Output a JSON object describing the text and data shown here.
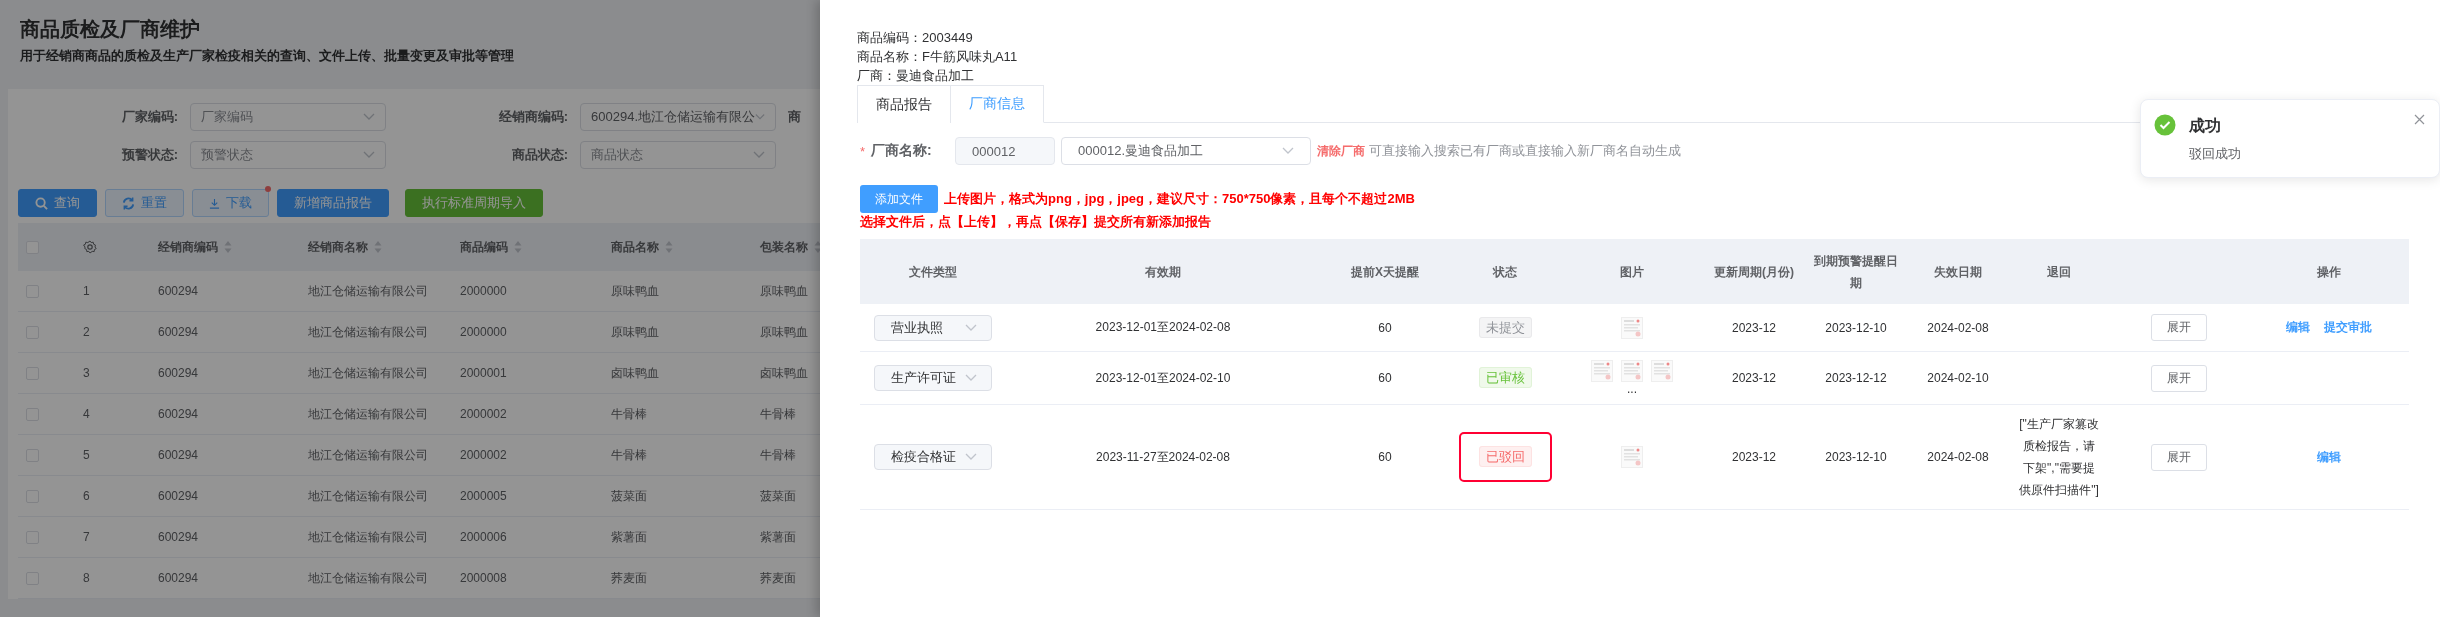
{
  "page": {
    "title": "商品质检及厂商维护",
    "subtitle": "用于经销商商品的质检及生产厂家检疫相关的查询、文件上传、批量变更及审批等管理"
  },
  "filters": [
    {
      "label": "厂家编码:",
      "placeholder": "厂家编码"
    },
    {
      "label": "经销商编码:",
      "value": "600294.地江仓储运输有限公"
    },
    {
      "label": "预警状态:",
      "placeholder": "预警状态"
    },
    {
      "label": "商品状态:",
      "placeholder": "商品状态"
    }
  ],
  "filter_cut_label": "商",
  "toolbar": [
    {
      "kind": "search",
      "label": "查询"
    },
    {
      "kind": "reset",
      "label": "重置"
    },
    {
      "kind": "download",
      "label": "下载",
      "dot": true
    },
    {
      "kind": "primary",
      "label": "新增商品报告"
    },
    {
      "kind": "success",
      "label": "执行标准周期导入"
    }
  ],
  "table": {
    "header_checked": false,
    "columns": [
      "经销商编码",
      "经销商名称",
      "商品编码",
      "商品名称",
      "包装名称"
    ],
    "rows": [
      {
        "checked": false,
        "index": "1",
        "cells": [
          "600294",
          "地江仓储运输有限公司",
          "2000000",
          "原味鸭血",
          "原味鸭血"
        ]
      },
      {
        "checked": false,
        "index": "2",
        "cells": [
          "600294",
          "地江仓储运输有限公司",
          "2000000",
          "原味鸭血",
          "原味鸭血"
        ]
      },
      {
        "checked": false,
        "index": "3",
        "cells": [
          "600294",
          "地江仓储运输有限公司",
          "2000001",
          "卤味鸭血",
          "卤味鸭血"
        ]
      },
      {
        "checked": false,
        "index": "4",
        "cells": [
          "600294",
          "地江仓储运输有限公司",
          "2000002",
          "牛骨棒",
          "牛骨棒"
        ]
      },
      {
        "checked": false,
        "index": "5",
        "cells": [
          "600294",
          "地江仓储运输有限公司",
          "2000002",
          "牛骨棒",
          "牛骨棒"
        ]
      },
      {
        "checked": false,
        "index": "6",
        "cells": [
          "600294",
          "地江仓储运输有限公司",
          "2000005",
          "菠菜面",
          "菠菜面"
        ]
      },
      {
        "checked": false,
        "index": "7",
        "cells": [
          "600294",
          "地江仓储运输有限公司",
          "2000006",
          "紫薯面",
          "紫薯面"
        ]
      },
      {
        "checked": false,
        "index": "8",
        "cells": [
          "600294",
          "地江仓储运输有限公司",
          "2000008",
          "荞麦面",
          "荞麦面"
        ]
      }
    ]
  },
  "drawer": {
    "info": [
      "商品编码：2003449",
      "商品名称：F牛筋风味丸A11",
      "厂商：曼迪食品加工"
    ],
    "tabs": [
      {
        "label": "商品报告",
        "selected": false
      },
      {
        "label": "厂商信息",
        "selected": true
      }
    ],
    "vendor": {
      "required_mark": "*",
      "label": "厂商名称:",
      "code": "000012",
      "name": "000012.曼迪食品加工",
      "clear": "清除厂商",
      "hint": "可直接输入搜索已有厂商或直接输入新厂商名自动生成"
    },
    "upload": {
      "button": "添加文件",
      "notes": [
        "上传图片，格式为png，jpg，jpeg，建议尺寸：750*750像素，且每个不超过2MB",
        "选择文件后，点【上传】，再点【保存】提交所有新添加报告"
      ]
    },
    "table": {
      "columns": [
        "文件类型",
        "有效期",
        "提前X天提醒",
        "状态",
        "图片",
        "更新周期(月份)",
        "到期预警提醒日期",
        "失效日期",
        "退回",
        "",
        "操作"
      ],
      "rows": [
        {
          "file_type": "营业执照",
          "validity": "2023-12-01至2024-02-08",
          "remind_days": "60",
          "status": {
            "kind": "pending",
            "label": "未提交"
          },
          "highlighted": false,
          "images": [
            {
              "kind": "picture"
            }
          ],
          "cycle": "2023-12",
          "warn_date": "2023-12-10",
          "expire_date": "2024-02-08",
          "expand": "展开",
          "actions": [
            "编辑",
            "提交审批"
          ]
        },
        {
          "file_type": "生产许可证",
          "validity": "2023-12-01至2024-02-10",
          "remind_days": "60",
          "status": {
            "kind": "approved",
            "label": "已审核"
          },
          "highlighted": false,
          "images": [
            {
              "kind": "picture"
            },
            {
              "kind": "picture"
            },
            {
              "kind": "picture"
            }
          ],
          "more": "...",
          "cycle": "2023-12",
          "warn_date": "2023-12-12",
          "expire_date": "2024-02-10",
          "expand": "展开"
        },
        {
          "file_type": "检疫合格证",
          "validity": "2023-11-27至2024-02-08",
          "remind_days": "60",
          "status": {
            "kind": "rejected",
            "label": "已驳回"
          },
          "highlighted": true,
          "images": [
            {
              "kind": "picture"
            }
          ],
          "cycle": "2023-12",
          "warn_date": "2023-12-10",
          "expire_date": "2024-02-08",
          "reason": "[\"生产厂家篡改质检报告，请下架\",\"需要提供原件扫描件\"]",
          "expand": "展开",
          "actions": [
            "编辑"
          ]
        }
      ]
    }
  },
  "toast": {
    "kind": "success",
    "title": "成功",
    "message": "驳回成功"
  }
}
